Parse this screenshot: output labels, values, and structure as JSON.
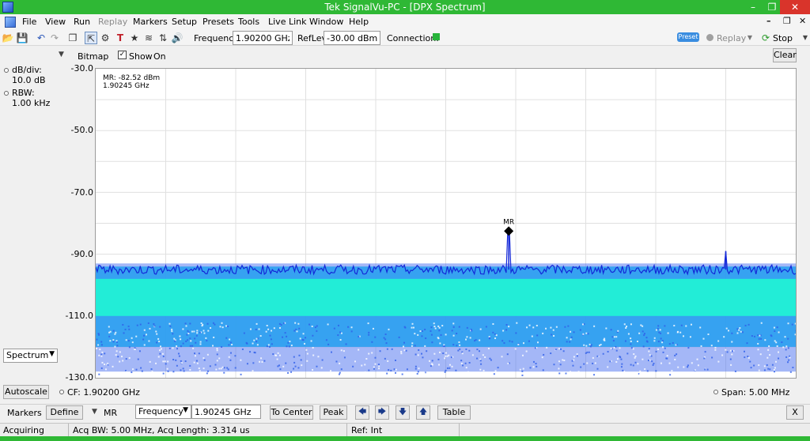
{
  "window": {
    "title": "Tek SignalVu-PC - [DPX Spectrum]"
  },
  "menu": {
    "items": [
      {
        "label": "File",
        "enabled": true
      },
      {
        "label": "View",
        "enabled": true
      },
      {
        "label": "Run",
        "enabled": true
      },
      {
        "label": "Replay",
        "enabled": false
      },
      {
        "label": "Markers",
        "enabled": true
      },
      {
        "label": "Setup",
        "enabled": true
      },
      {
        "label": "Presets",
        "enabled": true
      },
      {
        "label": "Tools",
        "enabled": true
      },
      {
        "label": "Live Link",
        "enabled": true
      },
      {
        "label": "Window",
        "enabled": true
      },
      {
        "label": "Help",
        "enabled": true
      }
    ]
  },
  "toolbar": {
    "frequency_label": "Frequency:",
    "frequency_value": "1.90200 GHz",
    "reflev_label": "RefLev:",
    "reflev_value": "-30.00 dBm",
    "connection_label": "Connection:",
    "connection_color": "#27b43a",
    "preset_label": "Preset",
    "replay_label": "Replay",
    "stop_label": "Stop"
  },
  "display": {
    "bitmap_label": "Bitmap",
    "show_label": "Show",
    "show_checked": true,
    "on_label": "On",
    "clear_label": "Clear",
    "dbdiv_label": "dB/div:",
    "dbdiv_value": "10.0 dB",
    "rbw_label": "RBW:",
    "rbw_value": "1.00 kHz",
    "view_select": "Spectrum",
    "autoscale_label": "Autoscale",
    "cf_text": "CF:  1.90200 GHz",
    "span_text": "Span:  5.00 MHz",
    "marker_readout_line1": "MR: -82.52 dBm",
    "marker_readout_line2": "1.90245 GHz",
    "marker_tag": "MR"
  },
  "markers_bar": {
    "markers_label": "Markers",
    "define_label": "Define",
    "marker_select": "MR",
    "mode_select": "Frequency",
    "marker_value": "1.90245 GHz",
    "to_center_label": "To Center",
    "peak_label": "Peak",
    "table_label": "Table",
    "close_label": "X"
  },
  "status": {
    "state": "Acquiring",
    "acq": "Acq BW: 5.00 MHz, Acq Length: 3.314 us",
    "ref": "Ref: Int"
  },
  "chart_data": {
    "type": "line",
    "title": "",
    "xlabel": "",
    "ylabel": "",
    "y_ticks": [
      "-30.0",
      "-50.0",
      "-70.0",
      "-90.0",
      "-110.0",
      "-130.0"
    ],
    "ylim": [
      -130,
      -30
    ],
    "xlim_ghz": [
      1.8995,
      1.9045
    ],
    "grid": true,
    "noise_floor_dbm": -95,
    "series": [
      {
        "x": [
          1.8995,
          1.9024,
          1.90245,
          1.9025,
          1.9039,
          1.904,
          1.9045
        ],
        "y": [
          -95,
          -95,
          -82.52,
          -95,
          -95,
          -89,
          -95
        ]
      }
    ],
    "marker": {
      "name": "MR",
      "x": 1.90245,
      "y": -82.52
    },
    "colors": {
      "trace": "#1428d8",
      "bitmap_hot": "#20f5d4",
      "bitmap_mid": "#2aa0f0",
      "bitmap_cold": "#4a6ff0"
    }
  }
}
